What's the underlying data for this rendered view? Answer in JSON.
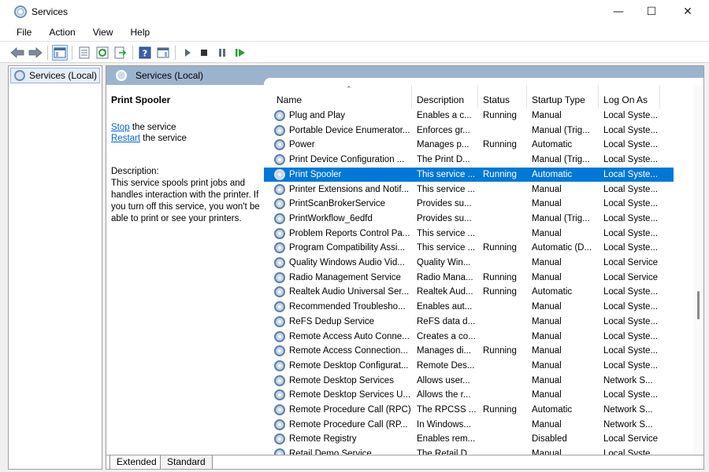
{
  "window": {
    "title": "Services",
    "minimize_glyph": "—",
    "maximize_glyph": "☐",
    "close_glyph": "✕"
  },
  "menu": [
    "File",
    "Action",
    "View",
    "Help"
  ],
  "toolbar": {
    "icons": [
      "back-arrow-icon",
      "forward-arrow-icon",
      "show-hide-console-tree-icon",
      "properties-icon",
      "refresh-icon",
      "export-list-icon",
      "help-icon",
      "show-hide-action-pane-icon",
      "start-service-icon",
      "stop-service-icon",
      "pause-service-icon",
      "restart-service-icon"
    ]
  },
  "tree": {
    "root_label": "Services (Local)"
  },
  "header": {
    "title": "Services (Local)"
  },
  "description_pane": {
    "service_name": "Print Spooler",
    "stop_link": "Stop",
    "stop_suffix": " the service",
    "restart_link": "Restart",
    "restart_suffix": " the service",
    "description_label": "Description:",
    "description_text": "This service spools print jobs and handles interaction with the printer. If you turn off this service, you won't be able to print or see your printers."
  },
  "columns": [
    "Name",
    "Description",
    "Status",
    "Startup Type",
    "Log On As"
  ],
  "rows": [
    {
      "name": "Plug and Play",
      "desc": "Enables a c...",
      "status": "Running",
      "startup": "Manual",
      "logon": "Local Syste..."
    },
    {
      "name": "Portable Device Enumerator...",
      "desc": "Enforces gr...",
      "status": "",
      "startup": "Manual (Trig...",
      "logon": "Local Syste..."
    },
    {
      "name": "Power",
      "desc": "Manages p...",
      "status": "Running",
      "startup": "Automatic",
      "logon": "Local Syste..."
    },
    {
      "name": "Print Device Configuration ...",
      "desc": "The Print D...",
      "status": "",
      "startup": "Manual (Trig...",
      "logon": "Local Syste..."
    },
    {
      "name": "Print Spooler",
      "desc": "This service ...",
      "status": "Running",
      "startup": "Automatic",
      "logon": "Local Syste...",
      "selected": true
    },
    {
      "name": "Printer Extensions and Notif...",
      "desc": "This service ...",
      "status": "",
      "startup": "Manual",
      "logon": "Local Syste..."
    },
    {
      "name": "PrintScanBrokerService",
      "desc": "Provides su...",
      "status": "",
      "startup": "Manual",
      "logon": "Local Syste..."
    },
    {
      "name": "PrintWorkflow_6edfd",
      "desc": "Provides su...",
      "status": "",
      "startup": "Manual (Trig...",
      "logon": "Local Syste..."
    },
    {
      "name": "Problem Reports Control Pa...",
      "desc": "This service ...",
      "status": "",
      "startup": "Manual",
      "logon": "Local Syste..."
    },
    {
      "name": "Program Compatibility Assi...",
      "desc": "This service ...",
      "status": "Running",
      "startup": "Automatic (D...",
      "logon": "Local Syste..."
    },
    {
      "name": "Quality Windows Audio Vid...",
      "desc": "Quality Win...",
      "status": "",
      "startup": "Manual",
      "logon": "Local Service"
    },
    {
      "name": "Radio Management Service",
      "desc": "Radio Mana...",
      "status": "Running",
      "startup": "Manual",
      "logon": "Local Service"
    },
    {
      "name": "Realtek Audio Universal Ser...",
      "desc": "Realtek Aud...",
      "status": "Running",
      "startup": "Automatic",
      "logon": "Local Syste..."
    },
    {
      "name": "Recommended Troublesho...",
      "desc": "Enables aut...",
      "status": "",
      "startup": "Manual",
      "logon": "Local Syste..."
    },
    {
      "name": "ReFS Dedup Service",
      "desc": "ReFS data d...",
      "status": "",
      "startup": "Manual",
      "logon": "Local Syste..."
    },
    {
      "name": "Remote Access Auto Conne...",
      "desc": "Creates a co...",
      "status": "",
      "startup": "Manual",
      "logon": "Local Syste..."
    },
    {
      "name": "Remote Access Connection...",
      "desc": "Manages di...",
      "status": "Running",
      "startup": "Manual",
      "logon": "Local Syste..."
    },
    {
      "name": "Remote Desktop Configurat...",
      "desc": "Remote Des...",
      "status": "",
      "startup": "Manual",
      "logon": "Local Syste..."
    },
    {
      "name": "Remote Desktop Services",
      "desc": "Allows user...",
      "status": "",
      "startup": "Manual",
      "logon": "Network S..."
    },
    {
      "name": "Remote Desktop Services U...",
      "desc": "Allows the r...",
      "status": "",
      "startup": "Manual",
      "logon": "Local Syste..."
    },
    {
      "name": "Remote Procedure Call (RPC)",
      "desc": "The RPCSS ...",
      "status": "Running",
      "startup": "Automatic",
      "logon": "Network S..."
    },
    {
      "name": "Remote Procedure Call (RP...",
      "desc": "In Windows...",
      "status": "",
      "startup": "Manual",
      "logon": "Network S..."
    },
    {
      "name": "Remote Registry",
      "desc": "Enables rem...",
      "status": "",
      "startup": "Disabled",
      "logon": "Local Service"
    },
    {
      "name": "Retail Demo Service",
      "desc": "The Retail D...",
      "status": "",
      "startup": "Manual",
      "logon": "Local Syste..."
    }
  ],
  "tabs": [
    "Extended",
    "Standard"
  ],
  "colors": {
    "selection": "#0078d7",
    "header_band": "#9cb3cd",
    "link": "#0066cc"
  }
}
